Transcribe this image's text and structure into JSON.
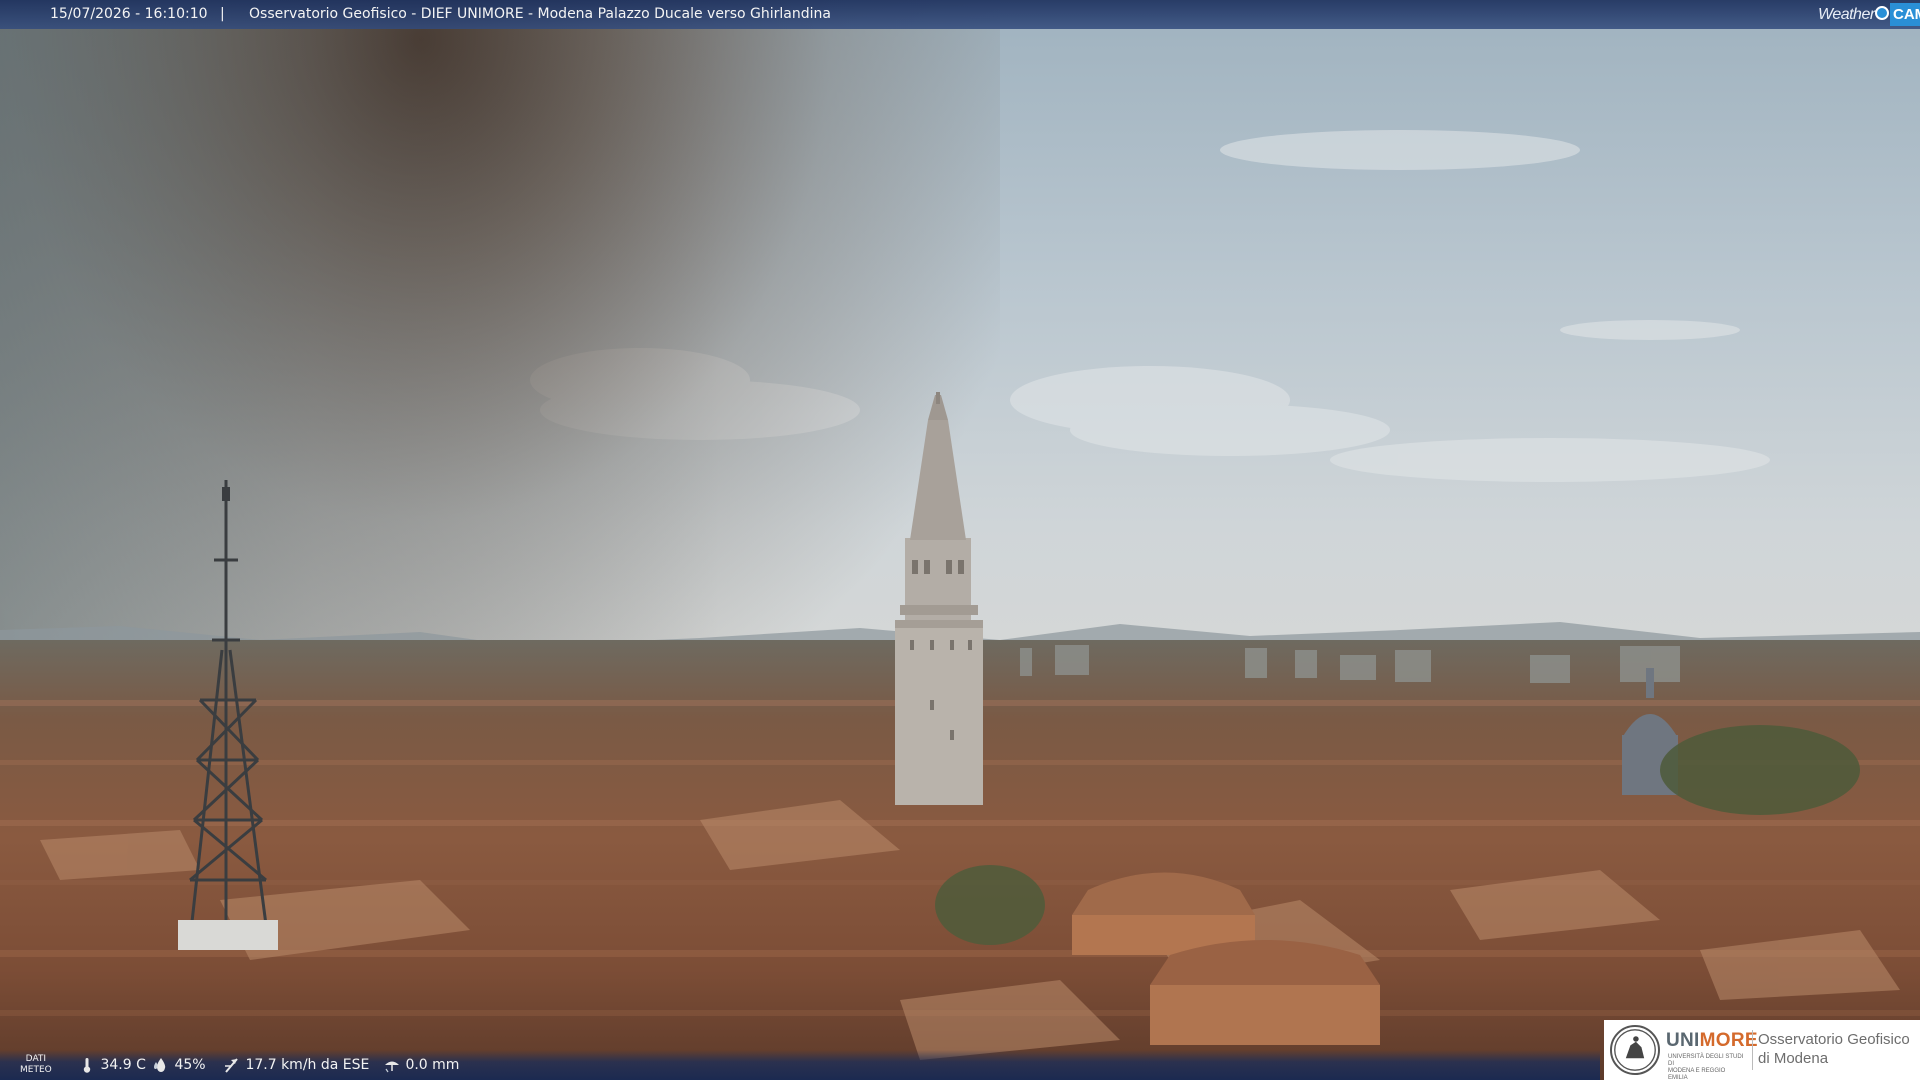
{
  "header": {
    "datetime": "15/07/2026 - 16:10:10",
    "separator": "|",
    "title": "Osservatorio Geofisico - DIEF UNIMORE - Modena Palazzo Ducale verso Ghirlandina"
  },
  "brand": {
    "weather": "Weather",
    "cam": "CAM",
    "accent": "#2a8fd6"
  },
  "weather_bar": {
    "label_line1": "DATI",
    "label_line2": "METEO",
    "temperature": "34.9 C",
    "humidity": "45%",
    "wind": "17.7 km/h da ESE",
    "rain": "0.0 mm",
    "icons": [
      "thermometer-icon",
      "humidity-drop-icon",
      "wind-vane-icon",
      "rain-gauge-icon"
    ]
  },
  "logo": {
    "uni": "UNI",
    "more": "MORE",
    "university_line1": "UNIVERSITÀ DEGLI STUDI DI",
    "university_line2": "MODENA E REGGIO EMILIA",
    "observatory_line1": "Osservatorio Geofisico",
    "observatory_line2": "di Modena",
    "more_color": "#d46a2c"
  }
}
